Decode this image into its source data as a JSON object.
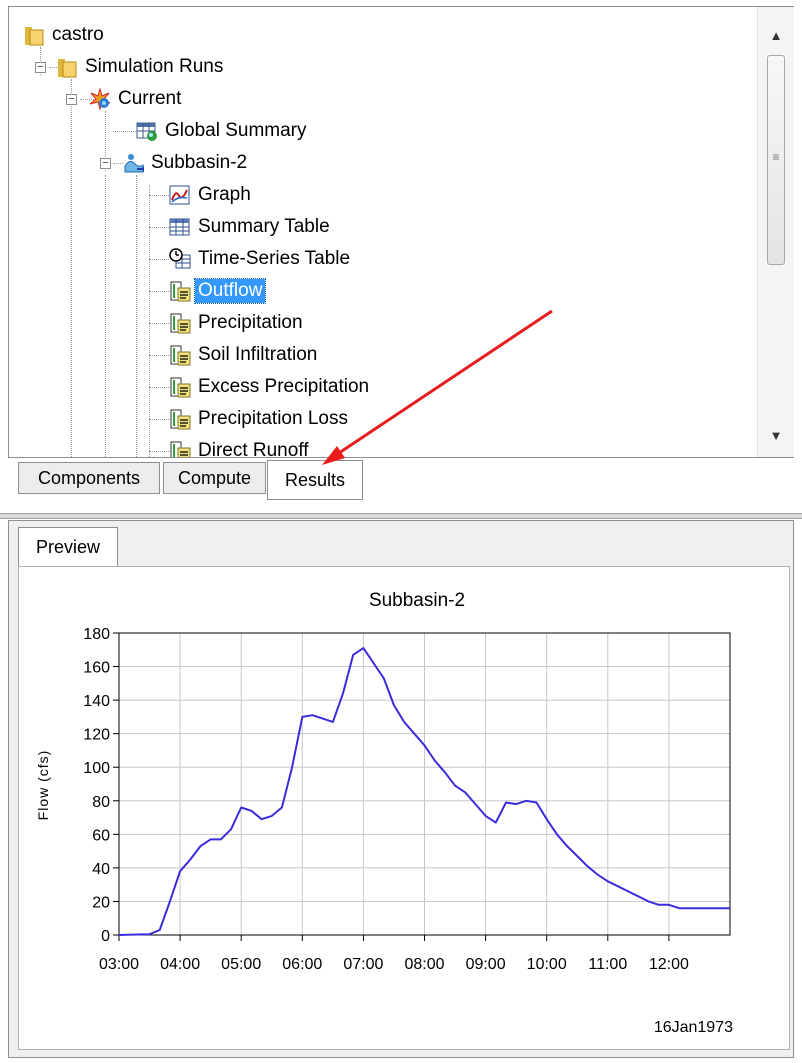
{
  "tree": {
    "items": [
      {
        "label": "castro",
        "icon": "folder-icon"
      },
      {
        "label": "Simulation Runs",
        "icon": "folder-icon"
      },
      {
        "label": "Current",
        "icon": "simulation-run-icon"
      },
      {
        "label": "Global Summary",
        "icon": "global-summary-icon"
      },
      {
        "label": "Subbasin-2",
        "icon": "subbasin-icon"
      },
      {
        "label": "Graph",
        "icon": "graph-icon"
      },
      {
        "label": "Summary Table",
        "icon": "table-icon"
      },
      {
        "label": "Time-Series Table",
        "icon": "time-series-table-icon"
      },
      {
        "label": "Outflow",
        "icon": "result-series-icon",
        "selected": true
      },
      {
        "label": "Precipitation",
        "icon": "result-series-icon"
      },
      {
        "label": "Soil Infiltration",
        "icon": "result-series-icon"
      },
      {
        "label": "Excess Precipitation",
        "icon": "result-series-icon"
      },
      {
        "label": "Precipitation Loss",
        "icon": "result-series-icon"
      },
      {
        "label": "Direct Runoff",
        "icon": "result-series-icon"
      }
    ]
  },
  "tabs": {
    "components": "Components",
    "compute": "Compute",
    "results": "Results",
    "active": "Results"
  },
  "preview": {
    "tab_label": "Preview"
  },
  "annotation": {
    "arrow_color": "#e81c1c",
    "points_to": "Results"
  },
  "colors": {
    "selection": "#3399ff",
    "series": "#3b2bdc",
    "grid": "#c8c8c8"
  },
  "chart_data": {
    "type": "line",
    "title": "Subbasin-2",
    "xlabel": "",
    "ylabel": "Flow (cfs)",
    "date_label": "16Jan1973",
    "x_ticks": [
      "03:00",
      "04:00",
      "05:00",
      "06:00",
      "07:00",
      "08:00",
      "09:00",
      "10:00",
      "11:00",
      "12:00"
    ],
    "y_ticks": [
      0,
      20,
      40,
      60,
      80,
      100,
      120,
      140,
      160,
      180
    ],
    "xlim": [
      "03:00",
      "13:00"
    ],
    "ylim": [
      0,
      180
    ],
    "grid": true,
    "series": [
      {
        "color": "#3b2bdc",
        "points": [
          [
            "03:00",
            0
          ],
          [
            "03:30",
            0.5
          ],
          [
            "03:40",
            3
          ],
          [
            "03:50",
            20
          ],
          [
            "04:00",
            38
          ],
          [
            "04:10",
            45
          ],
          [
            "04:20",
            53
          ],
          [
            "04:30",
            57
          ],
          [
            "04:40",
            57
          ],
          [
            "04:50",
            63
          ],
          [
            "05:00",
            76
          ],
          [
            "05:10",
            74
          ],
          [
            "05:20",
            69
          ],
          [
            "05:30",
            71
          ],
          [
            "05:40",
            76
          ],
          [
            "05:50",
            100
          ],
          [
            "06:00",
            130
          ],
          [
            "06:10",
            131
          ],
          [
            "06:20",
            129
          ],
          [
            "06:30",
            127
          ],
          [
            "06:40",
            144
          ],
          [
            "06:50",
            167
          ],
          [
            "07:00",
            171
          ],
          [
            "07:10",
            162
          ],
          [
            "07:20",
            153
          ],
          [
            "07:30",
            137
          ],
          [
            "07:40",
            127
          ],
          [
            "07:50",
            120
          ],
          [
            "08:00",
            113
          ],
          [
            "08:10",
            104
          ],
          [
            "08:20",
            97
          ],
          [
            "08:30",
            89
          ],
          [
            "08:40",
            85
          ],
          [
            "08:50",
            78
          ],
          [
            "09:00",
            71
          ],
          [
            "09:10",
            67
          ],
          [
            "09:20",
            79
          ],
          [
            "09:30",
            78
          ],
          [
            "09:40",
            80
          ],
          [
            "09:50",
            79
          ],
          [
            "10:00",
            69
          ],
          [
            "10:10",
            60
          ],
          [
            "10:20",
            53
          ],
          [
            "10:30",
            47
          ],
          [
            "10:40",
            41
          ],
          [
            "10:50",
            36
          ],
          [
            "11:00",
            32
          ],
          [
            "11:10",
            29
          ],
          [
            "11:20",
            26
          ],
          [
            "11:30",
            23
          ],
          [
            "11:40",
            20
          ],
          [
            "11:50",
            18
          ],
          [
            "12:00",
            18
          ],
          [
            "12:10",
            16
          ],
          [
            "12:30",
            16
          ],
          [
            "13:00",
            16
          ]
        ]
      }
    ]
  }
}
